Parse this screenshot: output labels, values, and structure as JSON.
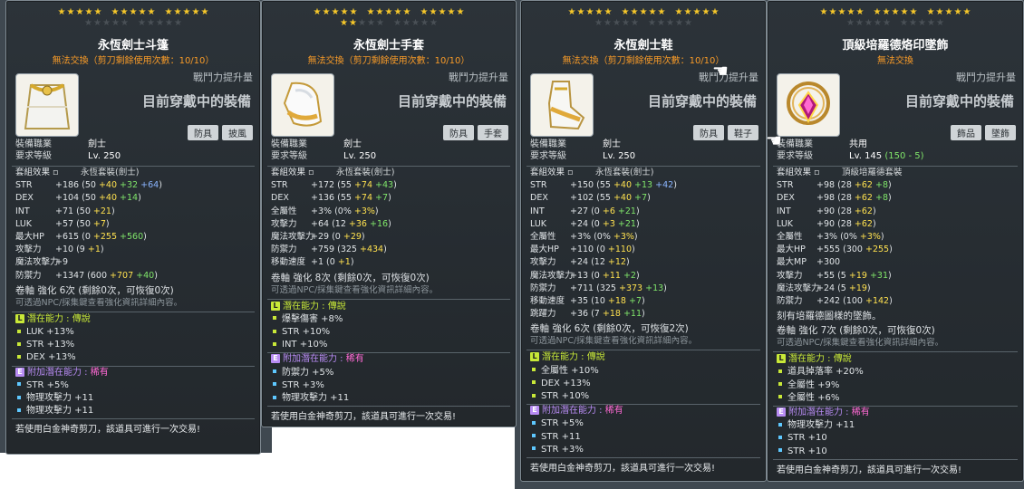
{
  "tooltips": [
    {
      "stars_row1": 15,
      "stars_row2": 0,
      "title": "永恆劍士斗篷",
      "subtitle": "無法交換（剪刀剩餘使用次數：10/10）",
      "fight_power_label": "戰鬥力提升量",
      "equipped_label": "目前穿戴中的裝備",
      "tags": [
        "防具",
        "披風"
      ],
      "job_label": "裝備職業",
      "job_value": "劍士",
      "req_level_label": "要求等級",
      "req_level_value": "Lv. 250",
      "set_label": "套組效果",
      "set_name": "永恆套裝(劍士)",
      "stats": [
        {
          "label": "STR",
          "total": "+186",
          "detail": [
            "(50 ",
            "+40",
            " ",
            "+32",
            " ",
            "+64",
            ")"
          ]
        },
        {
          "label": "DEX",
          "total": "+104",
          "detail": [
            "(50 ",
            "+40",
            " ",
            "+14",
            ")"
          ]
        },
        {
          "label": "INT",
          "total": "+71",
          "detail": [
            "(50 ",
            "+21",
            ")"
          ]
        },
        {
          "label": "LUK",
          "total": "+57",
          "detail": [
            "(50 ",
            "+7",
            ")"
          ]
        },
        {
          "label": "最大HP",
          "total": "+615",
          "detail": [
            "(0 ",
            "+255",
            " ",
            "+560",
            ")"
          ]
        },
        {
          "label": "攻擊力",
          "total": "+10",
          "detail": [
            "(9 ",
            "+1",
            ")"
          ]
        },
        {
          "label": "魔法攻擊力",
          "total": "+9",
          "detail": []
        },
        {
          "label": "防禦力",
          "total": "+1347",
          "detail": [
            "(600 ",
            "+707",
            " ",
            "+40",
            ")"
          ]
        }
      ],
      "scroll_line": "卷軸 強化 6次 (剩餘0次，可恢復0次)",
      "scroll_note": "可透過NPC/採集鍵查看強化資訊詳細內容。",
      "potential_title": "潛在能力",
      "potential_grade": "傳說",
      "potential": [
        "LUK +13%",
        "STR +13%",
        "DEX +13%"
      ],
      "bonus_title": "附加潛在能力",
      "bonus_grade": "稀有",
      "bonus": [
        "STR +5%",
        "物理攻擊力 +11",
        "物理攻擊力 +11"
      ],
      "footer": "若使用白金神奇剪刀，該道具可進行一次交易!"
    },
    {
      "stars_row1": 15,
      "stars_row2": 2,
      "title": "永恆劍士手套",
      "subtitle": "無法交換（剪刀剩餘使用次數：10/10）",
      "fight_power_label": "戰鬥力提升量",
      "equipped_label": "目前穿戴中的裝備",
      "tags": [
        "防具",
        "手套"
      ],
      "job_label": "裝備職業",
      "job_value": "劍士",
      "req_level_label": "要求等級",
      "req_level_value": "Lv. 250",
      "set_label": "套組效果",
      "set_name": "永恆套裝(劍士)",
      "stats": [
        {
          "label": "STR",
          "total": "+172",
          "detail": [
            "(55 ",
            "+74",
            " ",
            "+43",
            ")"
          ]
        },
        {
          "label": "DEX",
          "total": "+136",
          "detail": [
            "(55 ",
            "+74",
            " ",
            "+7",
            ")"
          ]
        },
        {
          "label": "全屬性",
          "total": "+3%",
          "detail": [
            "(0% ",
            "+3%",
            ")"
          ]
        },
        {
          "label": "攻擊力",
          "total": "+64",
          "detail": [
            "(12 ",
            "+36",
            " ",
            "+16",
            ")"
          ]
        },
        {
          "label": "魔法攻擊力",
          "total": "+29",
          "detail": [
            "(0 ",
            "+29",
            ")"
          ]
        },
        {
          "label": "防禦力",
          "total": "+759",
          "detail": [
            "(325 ",
            "+434",
            ")"
          ]
        },
        {
          "label": "移動速度",
          "total": "+1",
          "detail": [
            "(0 ",
            "+1",
            ")"
          ]
        }
      ],
      "scroll_line": "卷軸 強化 8次 (剩餘0次，可恢復0次)",
      "scroll_note": "可透過NPC/採集鍵查看強化資訊詳細內容。",
      "potential_title": "潛在能力",
      "potential_grade": "傳說",
      "potential": [
        "爆擊傷害 +8%",
        "STR +10%",
        "INT +10%"
      ],
      "bonus_title": "附加潛在能力",
      "bonus_grade": "稀有",
      "bonus": [
        "防禦力 +5%",
        "STR +3%",
        "物理攻擊力 +11"
      ],
      "footer": "若使用白金神奇剪刀，該道具可進行一次交易!"
    },
    {
      "stars_row1": 15,
      "stars_row2": 0,
      "title": "永恆劍士鞋",
      "subtitle": "無法交換（剪刀剩餘使用次數：10/10）",
      "fight_power_label": "戰鬥力提升量",
      "equipped_label": "目前穿戴中的裝備",
      "tags": [
        "防具",
        "鞋子"
      ],
      "job_label": "裝備職業",
      "job_value": "劍士",
      "req_level_label": "要求等級",
      "req_level_value": "Lv. 250",
      "set_label": "套組效果",
      "set_name": "永恆套裝(劍士)",
      "stats": [
        {
          "label": "STR",
          "total": "+150",
          "detail": [
            "(55 ",
            "+40",
            " ",
            "+13",
            " ",
            "+42",
            ")"
          ]
        },
        {
          "label": "DEX",
          "total": "+102",
          "detail": [
            "(55 ",
            "+40",
            " ",
            "+7",
            ")"
          ]
        },
        {
          "label": "INT",
          "total": "+27",
          "detail": [
            "(0 ",
            "+6",
            " ",
            "+21",
            ")"
          ]
        },
        {
          "label": "LUK",
          "total": "+24",
          "detail": [
            "(0 ",
            "+3",
            " ",
            "+21",
            ")"
          ]
        },
        {
          "label": "全屬性",
          "total": "+3%",
          "detail": [
            "(0% ",
            "+3%",
            ")"
          ]
        },
        {
          "label": "最大HP",
          "total": "+110",
          "detail": [
            "(0 ",
            "+110",
            ")"
          ]
        },
        {
          "label": "攻擊力",
          "total": "+24",
          "detail": [
            "(12 ",
            "+12",
            ")"
          ]
        },
        {
          "label": "魔法攻擊力",
          "total": "+13",
          "detail": [
            "(0 ",
            "+11",
            " ",
            "+2",
            ")"
          ]
        },
        {
          "label": "防禦力",
          "total": "+711",
          "detail": [
            "(325 ",
            "+373",
            " ",
            "+13",
            ")"
          ]
        },
        {
          "label": "移動速度",
          "total": "+35",
          "detail": [
            "(10 ",
            "+18",
            " ",
            "+7",
            ")"
          ]
        },
        {
          "label": "跳躍力",
          "total": "+36",
          "detail": [
            "(7 ",
            "+18",
            " ",
            "+11",
            ")"
          ]
        }
      ],
      "scroll_line": "卷軸 強化 6次 (剩餘0次，可恢復2次)",
      "scroll_note": "可透過NPC/採集鍵查看強化資訊詳細內容。",
      "potential_title": "潛在能力",
      "potential_grade": "傳說",
      "potential": [
        "全屬性 +10%",
        "DEX +13%",
        "STR +10%"
      ],
      "bonus_title": "附加潛在能力",
      "bonus_grade": "稀有",
      "bonus": [
        "STR +5%",
        "STR +11",
        "STR +3%"
      ],
      "footer": "若使用白金神奇剪刀，該道具可進行一次交易!"
    },
    {
      "stars_row1": 15,
      "stars_row2": 0,
      "title": "頂級培羅德烙印墜飾",
      "subtitle": "無法交換",
      "fight_power_label": "戰鬥力提升量",
      "equipped_label": "目前穿戴中的裝備",
      "tags": [
        "飾品",
        "墜飾"
      ],
      "job_label": "裝備職業",
      "job_value": "共用",
      "req_level_label": "要求等級",
      "req_level_value": "Lv. 145",
      "req_level_extra": "(150 - 5)",
      "set_label": "套組效果",
      "set_name": "頂級培羅德套裝",
      "stats": [
        {
          "label": "STR",
          "total": "+98",
          "detail": [
            "(28 ",
            "+62",
            " ",
            "+8",
            ")"
          ]
        },
        {
          "label": "DEX",
          "total": "+98",
          "detail": [
            "(28 ",
            "+62",
            " ",
            "+8",
            ")"
          ]
        },
        {
          "label": "INT",
          "total": "+90",
          "detail": [
            "(28 ",
            "+62",
            ")"
          ]
        },
        {
          "label": "LUK",
          "total": "+90",
          "detail": [
            "(28 ",
            "+62",
            ")"
          ]
        },
        {
          "label": "全屬性",
          "total": "+3%",
          "detail": [
            "(0% ",
            "+3%",
            ")"
          ]
        },
        {
          "label": "最大HP",
          "total": "+555",
          "detail": [
            "(300 ",
            "+255",
            ")"
          ]
        },
        {
          "label": "最大MP",
          "total": "+300",
          "detail": []
        },
        {
          "label": "攻擊力",
          "total": "+55",
          "detail": [
            "(5 ",
            "+19",
            " ",
            "+31",
            ")"
          ]
        },
        {
          "label": "魔法攻擊力",
          "total": "+24",
          "detail": [
            "(5 ",
            "+19",
            ")"
          ]
        },
        {
          "label": "防禦力",
          "total": "+242",
          "detail": [
            "(100 ",
            "+142",
            ")"
          ]
        }
      ],
      "extra_note": "刻有培羅德圖樣的墜飾。",
      "scroll_line": "卷軸 強化 7次 (剩餘0次，可恢復0次)",
      "scroll_note": "可透過NPC/採集鍵查看強化資訊詳細內容。",
      "potential_title": "潛在能力",
      "potential_grade": "傳說",
      "potential": [
        "道具掉落率 +20%",
        "全屬性 +9%",
        "全屬性 +6%"
      ],
      "bonus_title": "附加潛在能力",
      "bonus_grade": "稀有",
      "bonus": [
        "物理攻擊力 +11",
        "STR +10",
        "STR +10"
      ],
      "footer": "若使用白金神奇剪刀，該道具可進行一次交易!"
    }
  ],
  "colors": {
    "panel": "#262c31",
    "title": "#ffffff",
    "subtitle": "#f89b28",
    "legend": "#c8e838",
    "rare": "#ff6ad5"
  }
}
